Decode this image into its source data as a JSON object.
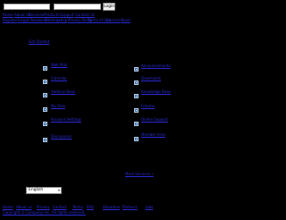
{
  "login": {
    "username_value": "",
    "password_value": "",
    "button_label": "Login"
  },
  "top_links_row1": [
    "Home",
    "About Us",
    "Services",
    "Products",
    "Support",
    "Contact Us"
  ],
  "top_links_row2": [
    "Register",
    "Forgot Password",
    "Sitemap",
    "Help",
    "Privacy Policy",
    "Terms of Use",
    "Careers",
    "News"
  ],
  "section_link": "Get Started",
  "left_tiles": [
    "Web Mail",
    "Calendar",
    "Address Book",
    "My Files",
    "Account Settings",
    "Discussions"
  ],
  "right_tiles": [
    "Announcements",
    "Downloads",
    "Knowledge Base",
    "Forums",
    "Online Support",
    "Member Area"
  ],
  "more_link": "More Services »",
  "language": {
    "selected": "English"
  },
  "footer_row1": [
    "Home",
    "About us",
    "Privacy",
    "Contact",
    "Terms",
    "FAQ",
    "Advertise",
    "Partners",
    "Jobs"
  ],
  "footer_row2": "Copyright © Company Inc. All rights reserved."
}
